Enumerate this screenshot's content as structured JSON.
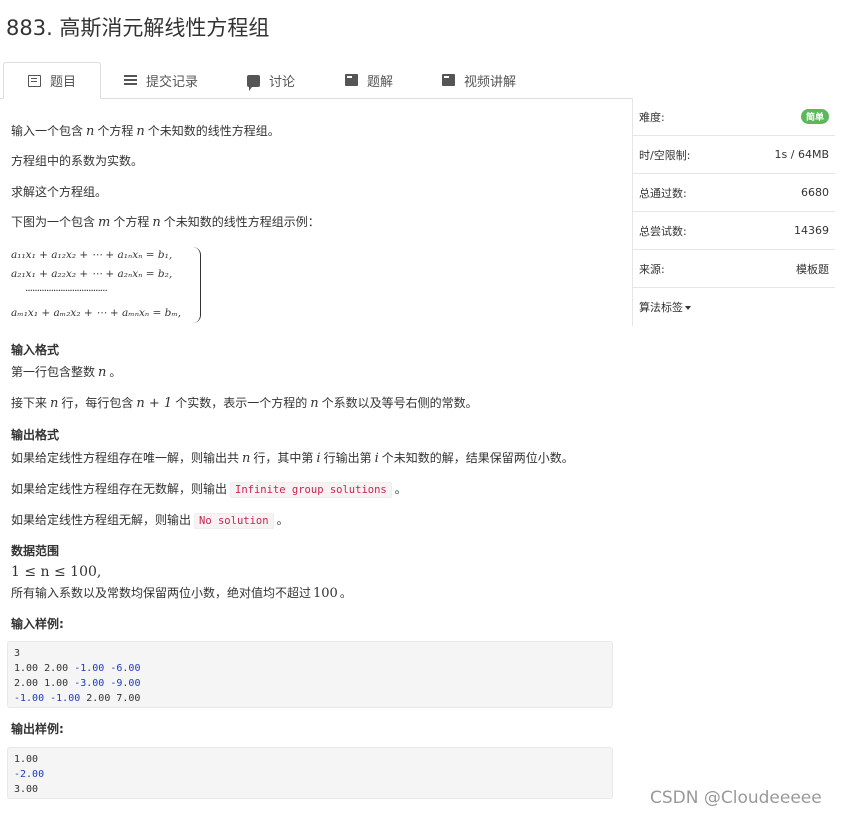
{
  "problem": {
    "title": "883. 高斯消元解线性方程组"
  },
  "tabs": [
    {
      "label": "题目",
      "icon": "document-icon"
    },
    {
      "label": "提交记录",
      "icon": "list-icon"
    },
    {
      "label": "讨论",
      "icon": "comment-icon"
    },
    {
      "label": "题解",
      "icon": "book-icon"
    },
    {
      "label": "视频讲解",
      "icon": "book-icon"
    }
  ],
  "body": {
    "intro": {
      "a": "输入一个包含",
      "v1": "n",
      "b": "个方程",
      "v2": "n",
      "c": "个未知数的线性方程组。"
    },
    "coef": "方程组中的系数为实数。",
    "solve": "求解这个方程组。",
    "example": {
      "a": "下图为一个包含",
      "v1": "m",
      "b": "个方程",
      "v2": "n",
      "c": "个未知数的线性方程组示例："
    },
    "equations": {
      "row1": "a₁₁x₁ + a₁₂x₂ + ⋯ + a₁ₙxₙ = b₁,",
      "row2": "a₂₁x₁ + a₂₂x₂ + ⋯ + a₂ₙxₙ = b₂,",
      "dots": "···································",
      "row3": "aₘ₁x₁ + aₘ₂x₂ + ⋯ + aₘₙxₙ = bₘ,"
    },
    "input_heading": "输入格式",
    "input_line1": {
      "a": "第一行包含整数",
      "v": "n",
      "b": "。"
    },
    "input_line2": {
      "a": "接下来",
      "v1": "n",
      "b": "行，每行包含",
      "v2": "n + 1",
      "c": "个实数，表示一个方程的",
      "v3": "n",
      "d": "个系数以及等号右侧的常数。"
    },
    "output_heading": "输出格式",
    "output_line1": {
      "a": "如果给定线性方程组存在唯一解，则输出共",
      "v1": "n",
      "b": "行，其中第",
      "v2": "i",
      "c": "行输出第",
      "v3": "i",
      "d": "个未知数的解，结果保留两位小数。"
    },
    "output_line2": {
      "a": "如果给定线性方程组存在无数解，则输出",
      "code": "Infinite group solutions",
      "b": "。"
    },
    "output_line3": {
      "a": "如果给定线性方程组无解，则输出",
      "code": "No solution",
      "b": "。"
    },
    "range_heading": "数据范围",
    "range_formula": "1 ≤ n ≤ 100,",
    "range_line": {
      "a": "所有输入系数以及常数均保留两位小数，绝对值均不超过",
      "v": "100",
      "b": "。"
    },
    "sample_input_heading": "输入样例:",
    "sample_input": [
      "3",
      "1.00 2.00 -1.00 -6.00",
      "2.00 1.00 -3.00 -9.00",
      "-1.00 -1.00 2.00 7.00"
    ],
    "sample_output_heading": "输出样例:",
    "sample_output": [
      "1.00",
      "-2.00",
      "3.00"
    ]
  },
  "sidebar": {
    "difficulty": {
      "label": "难度:",
      "value": "简单",
      "color": "#5cb85c"
    },
    "limits": {
      "label": "时/空限制:",
      "value": "1s / 64MB"
    },
    "passed": {
      "label": "总通过数:",
      "value": "6680"
    },
    "attempts": {
      "label": "总尝试数:",
      "value": "14369"
    },
    "source": {
      "label": "来源:",
      "value": "模板题"
    },
    "tags": {
      "label": "算法标签"
    }
  },
  "watermark": "CSDN @Cloudeeeee"
}
